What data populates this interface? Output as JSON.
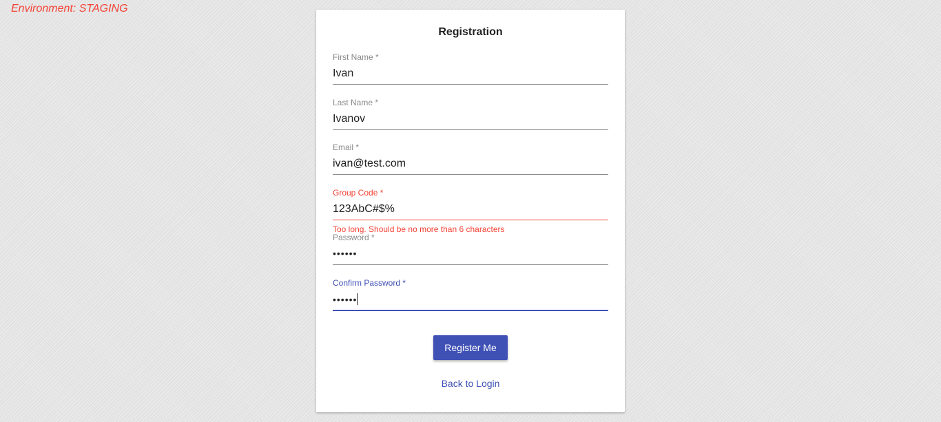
{
  "environment_label": "Environment: STAGING",
  "form": {
    "title": "Registration",
    "fields": {
      "first_name": {
        "label": "First Name *",
        "value": "Ivan"
      },
      "last_name": {
        "label": "Last Name *",
        "value": "Ivanov"
      },
      "email": {
        "label": "Email *",
        "value": "ivan@test.com"
      },
      "group_code": {
        "label": "Group Code *",
        "value": "123AbC#$%",
        "error": "Too long. Should be no more than 6 characters"
      },
      "password": {
        "label": "Password *",
        "value": "••••••"
      },
      "confirm_password": {
        "label": "Confirm Password *",
        "value": "••••••"
      }
    },
    "submit_label": "Register Me",
    "back_link_label": "Back to Login"
  },
  "colors": {
    "primary": "#3f51b5",
    "error": "#f44336",
    "environment_label": "#f44336"
  }
}
